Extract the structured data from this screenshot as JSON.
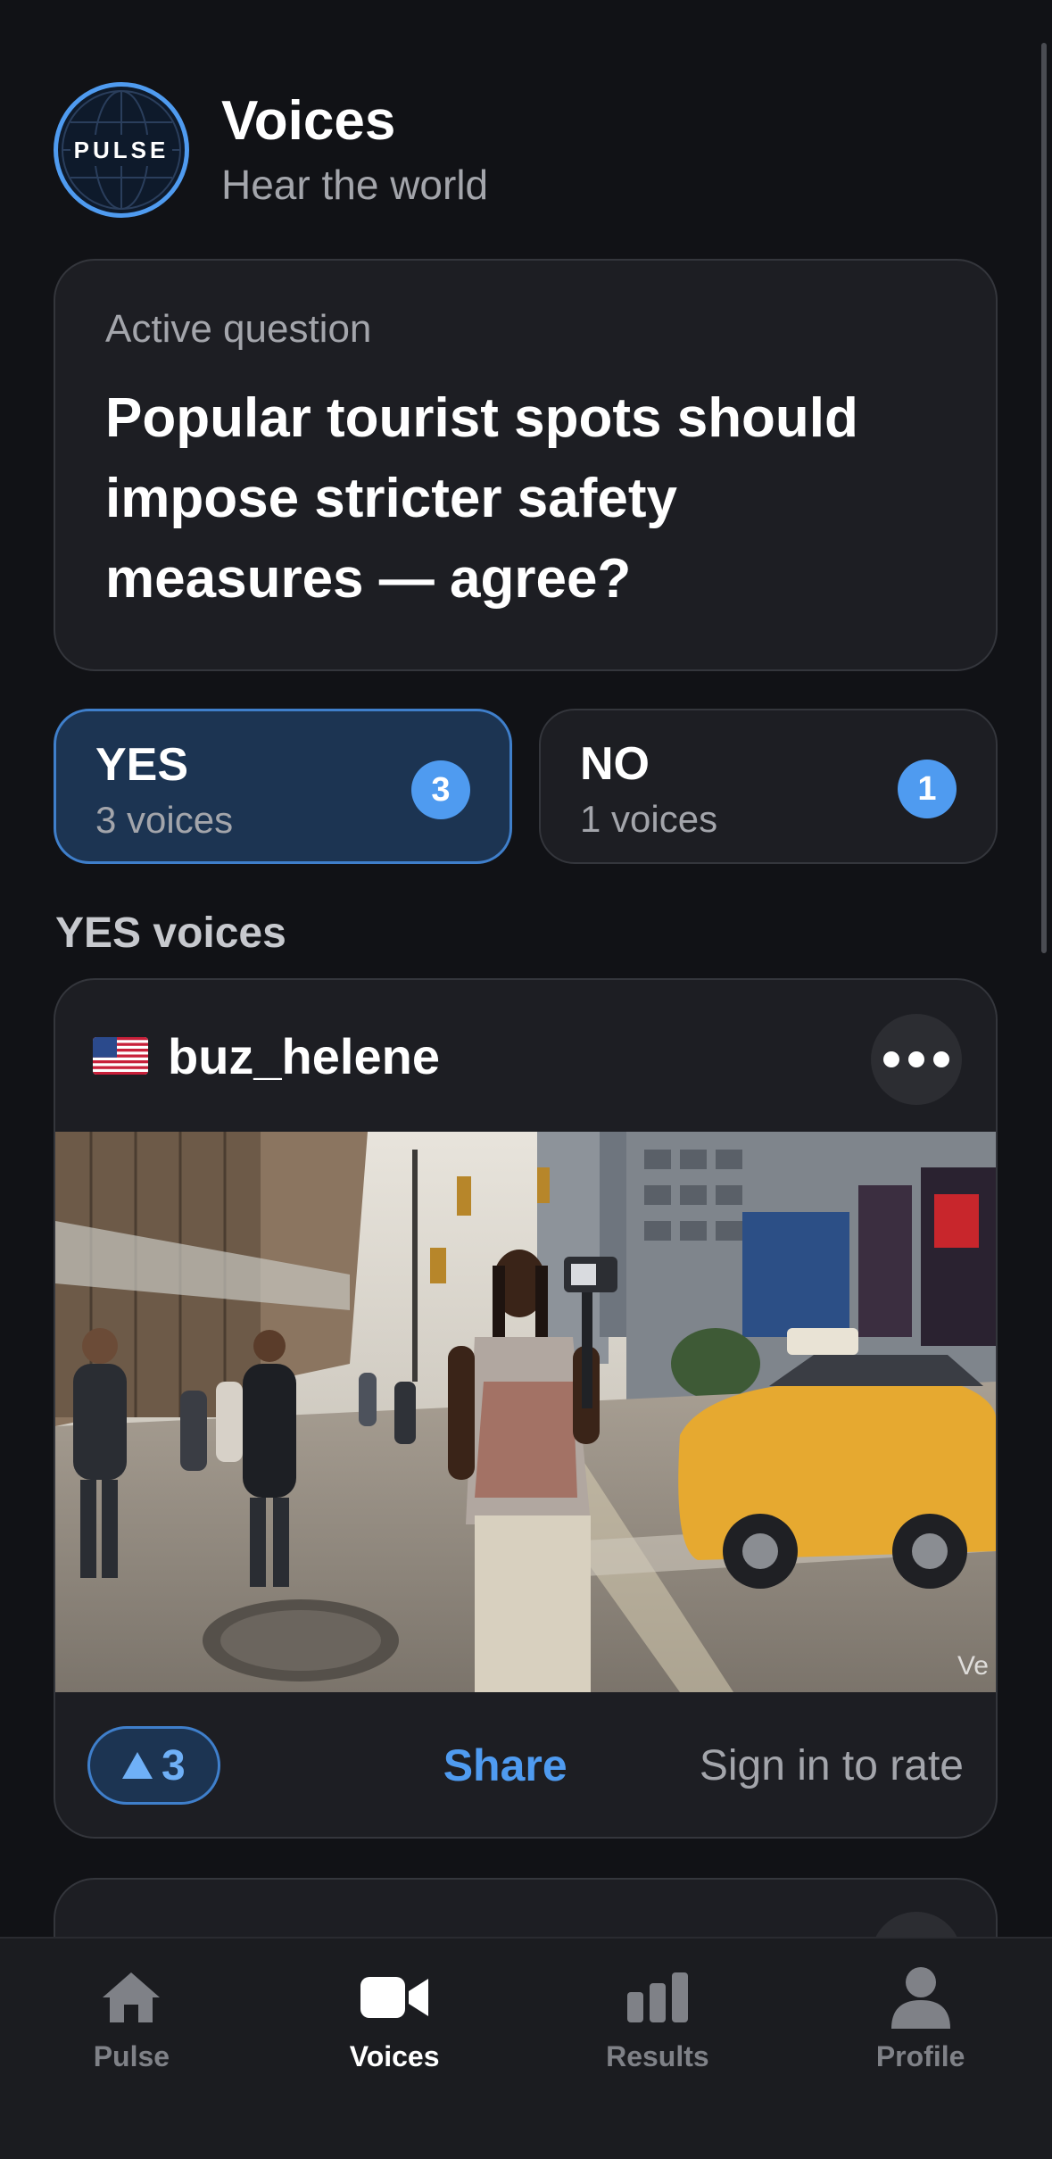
{
  "header": {
    "logo_text": "PULSE",
    "title": "Voices",
    "subtitle": "Hear the world"
  },
  "question": {
    "label": "Active question",
    "text": "Popular tourist spots should impose stricter safety measures — agree?"
  },
  "votes": {
    "yes": {
      "label": "YES",
      "count_text": "3 voices",
      "badge": "3"
    },
    "no": {
      "label": "NO",
      "count_text": "1 voices",
      "badge": "1"
    }
  },
  "section_title": "YES voices",
  "post": {
    "flag": "us-flag",
    "username": "buz_helene",
    "watermark": "Ve",
    "upvotes": "3",
    "share_label": "Share",
    "rate_label": "Sign in to rate"
  },
  "tabs": [
    {
      "label": "Pulse",
      "icon": "home-icon",
      "active": false
    },
    {
      "label": "Voices",
      "icon": "video-icon",
      "active": true
    },
    {
      "label": "Results",
      "icon": "bar-chart-icon",
      "active": false
    },
    {
      "label": "Profile",
      "icon": "person-icon",
      "active": false
    }
  ],
  "colors": {
    "accent": "#4f9bf0",
    "background": "#111216",
    "card": "#1d1e23",
    "yes_selected_bg": "#1c3452"
  }
}
